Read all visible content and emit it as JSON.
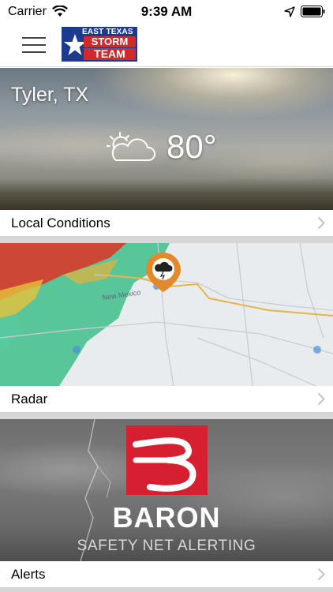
{
  "status_bar": {
    "carrier": "Carrier",
    "time": "9:39 AM"
  },
  "nav": {
    "logo": {
      "line1": "EAST TEXAS",
      "line2": "STORM",
      "line3": "TEAM"
    }
  },
  "weather": {
    "city": "Tyler, TX",
    "temperature": "80°",
    "condition_icon": "partly-sunny-icon",
    "label": "Local Conditions"
  },
  "radar": {
    "label": "Radar",
    "map_labels": [
      "New Mexico"
    ]
  },
  "alerts": {
    "brand": "BARON",
    "tagline": "SAFETY NET ALERTING",
    "label": "Alerts"
  },
  "colors": {
    "logo_blue": "#1c3b8f",
    "logo_red": "#d12a2a",
    "baron_red": "#d7202f",
    "radar_orange": "#e3892a"
  }
}
